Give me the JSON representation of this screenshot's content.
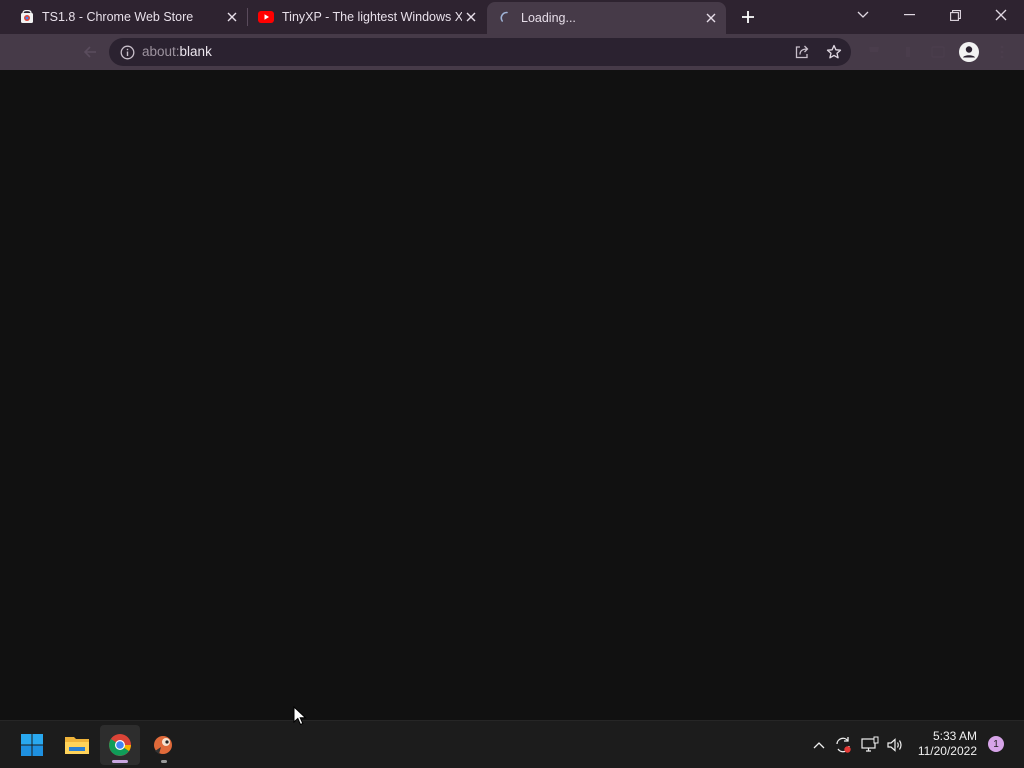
{
  "tabs": [
    {
      "title": "TS1.8 - Chrome Web Store",
      "favicon": "chrome-web-store-icon"
    },
    {
      "title": "TinyXP - The lightest Windows XP",
      "favicon": "youtube-icon"
    },
    {
      "title": "Loading...",
      "favicon": "loading-spinner-icon",
      "active": true
    }
  ],
  "omnibox": {
    "prefix": "about:",
    "host": "blank"
  },
  "colors": {
    "titlebar": "#2e2330",
    "toolbar": "#463a48",
    "page": "#111111",
    "taskbar": "#1c1c1c",
    "accent": "#d6a4e8"
  },
  "taskbar": {
    "apps": [
      "windows-start-icon",
      "file-explorer-icon",
      "chrome-icon",
      "app-bird-icon"
    ],
    "clock": {
      "time": "5:33 AM",
      "date": "11/20/2022"
    },
    "notification_count": "1"
  }
}
